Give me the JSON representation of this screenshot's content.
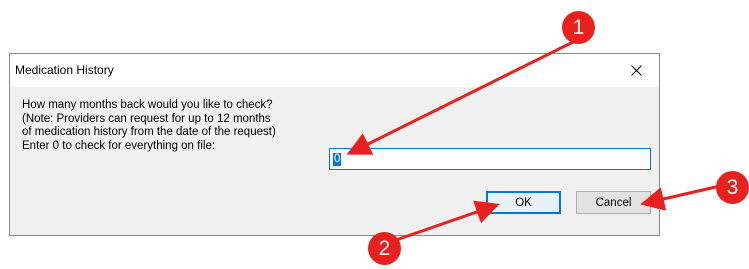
{
  "dialog": {
    "title": "Medication History",
    "close_glyph": "✕",
    "prompt_lines": [
      "How many months back would you like to check?",
      "(Note: Providers can request for up to 12 months",
      "of medication history from the date of the request)",
      "Enter 0 to check for everything on file:"
    ],
    "months_input_value": "0",
    "ok_label": "OK",
    "cancel_label": "Cancel"
  },
  "annotations": {
    "marker_1": "1",
    "marker_2": "2",
    "marker_3": "3",
    "color": "#e8211e"
  }
}
